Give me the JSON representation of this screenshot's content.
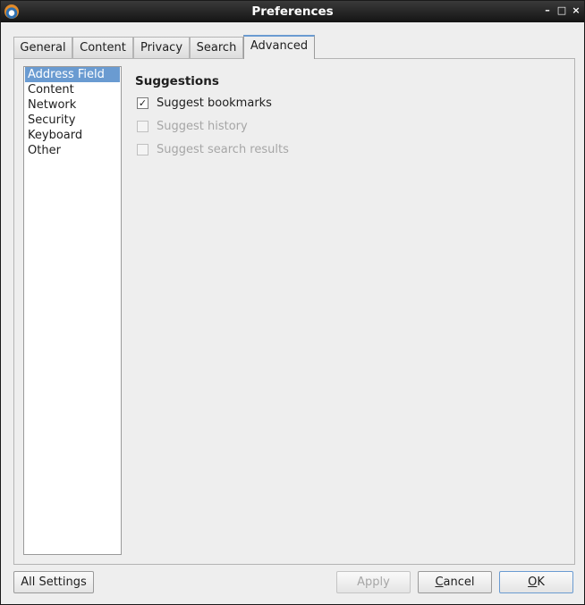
{
  "window": {
    "title": "Preferences",
    "controls": {
      "minimize": "–",
      "maximize": "□",
      "close": "×"
    }
  },
  "tabs": [
    {
      "label": "General"
    },
    {
      "label": "Content"
    },
    {
      "label": "Privacy"
    },
    {
      "label": "Search"
    },
    {
      "label": "Advanced",
      "selected": true
    }
  ],
  "sidebar": {
    "items": [
      {
        "label": "Address Field",
        "selected": true
      },
      {
        "label": "Content"
      },
      {
        "label": "Network"
      },
      {
        "label": "Security"
      },
      {
        "label": "Keyboard"
      },
      {
        "label": "Other"
      }
    ]
  },
  "suggestions": {
    "title": "Suggestions",
    "options": [
      {
        "label": "Suggest bookmarks",
        "checked": true,
        "enabled": true
      },
      {
        "label": "Suggest history",
        "checked": false,
        "enabled": false
      },
      {
        "label": "Suggest search results",
        "checked": false,
        "enabled": false
      }
    ]
  },
  "buttons": {
    "all_settings": "All Settings",
    "apply": "Apply",
    "cancel_mnemonic": "C",
    "cancel_rest": "ancel",
    "ok_mnemonic": "O",
    "ok_rest": "K"
  },
  "colors": {
    "accent": "#6a9bd1",
    "titlebar": "#141414",
    "window_bg": "#eeeeee",
    "disabled_text": "#a6a6a6"
  },
  "icons": {
    "app": "browser-app-icon",
    "checkmark": "✓"
  }
}
